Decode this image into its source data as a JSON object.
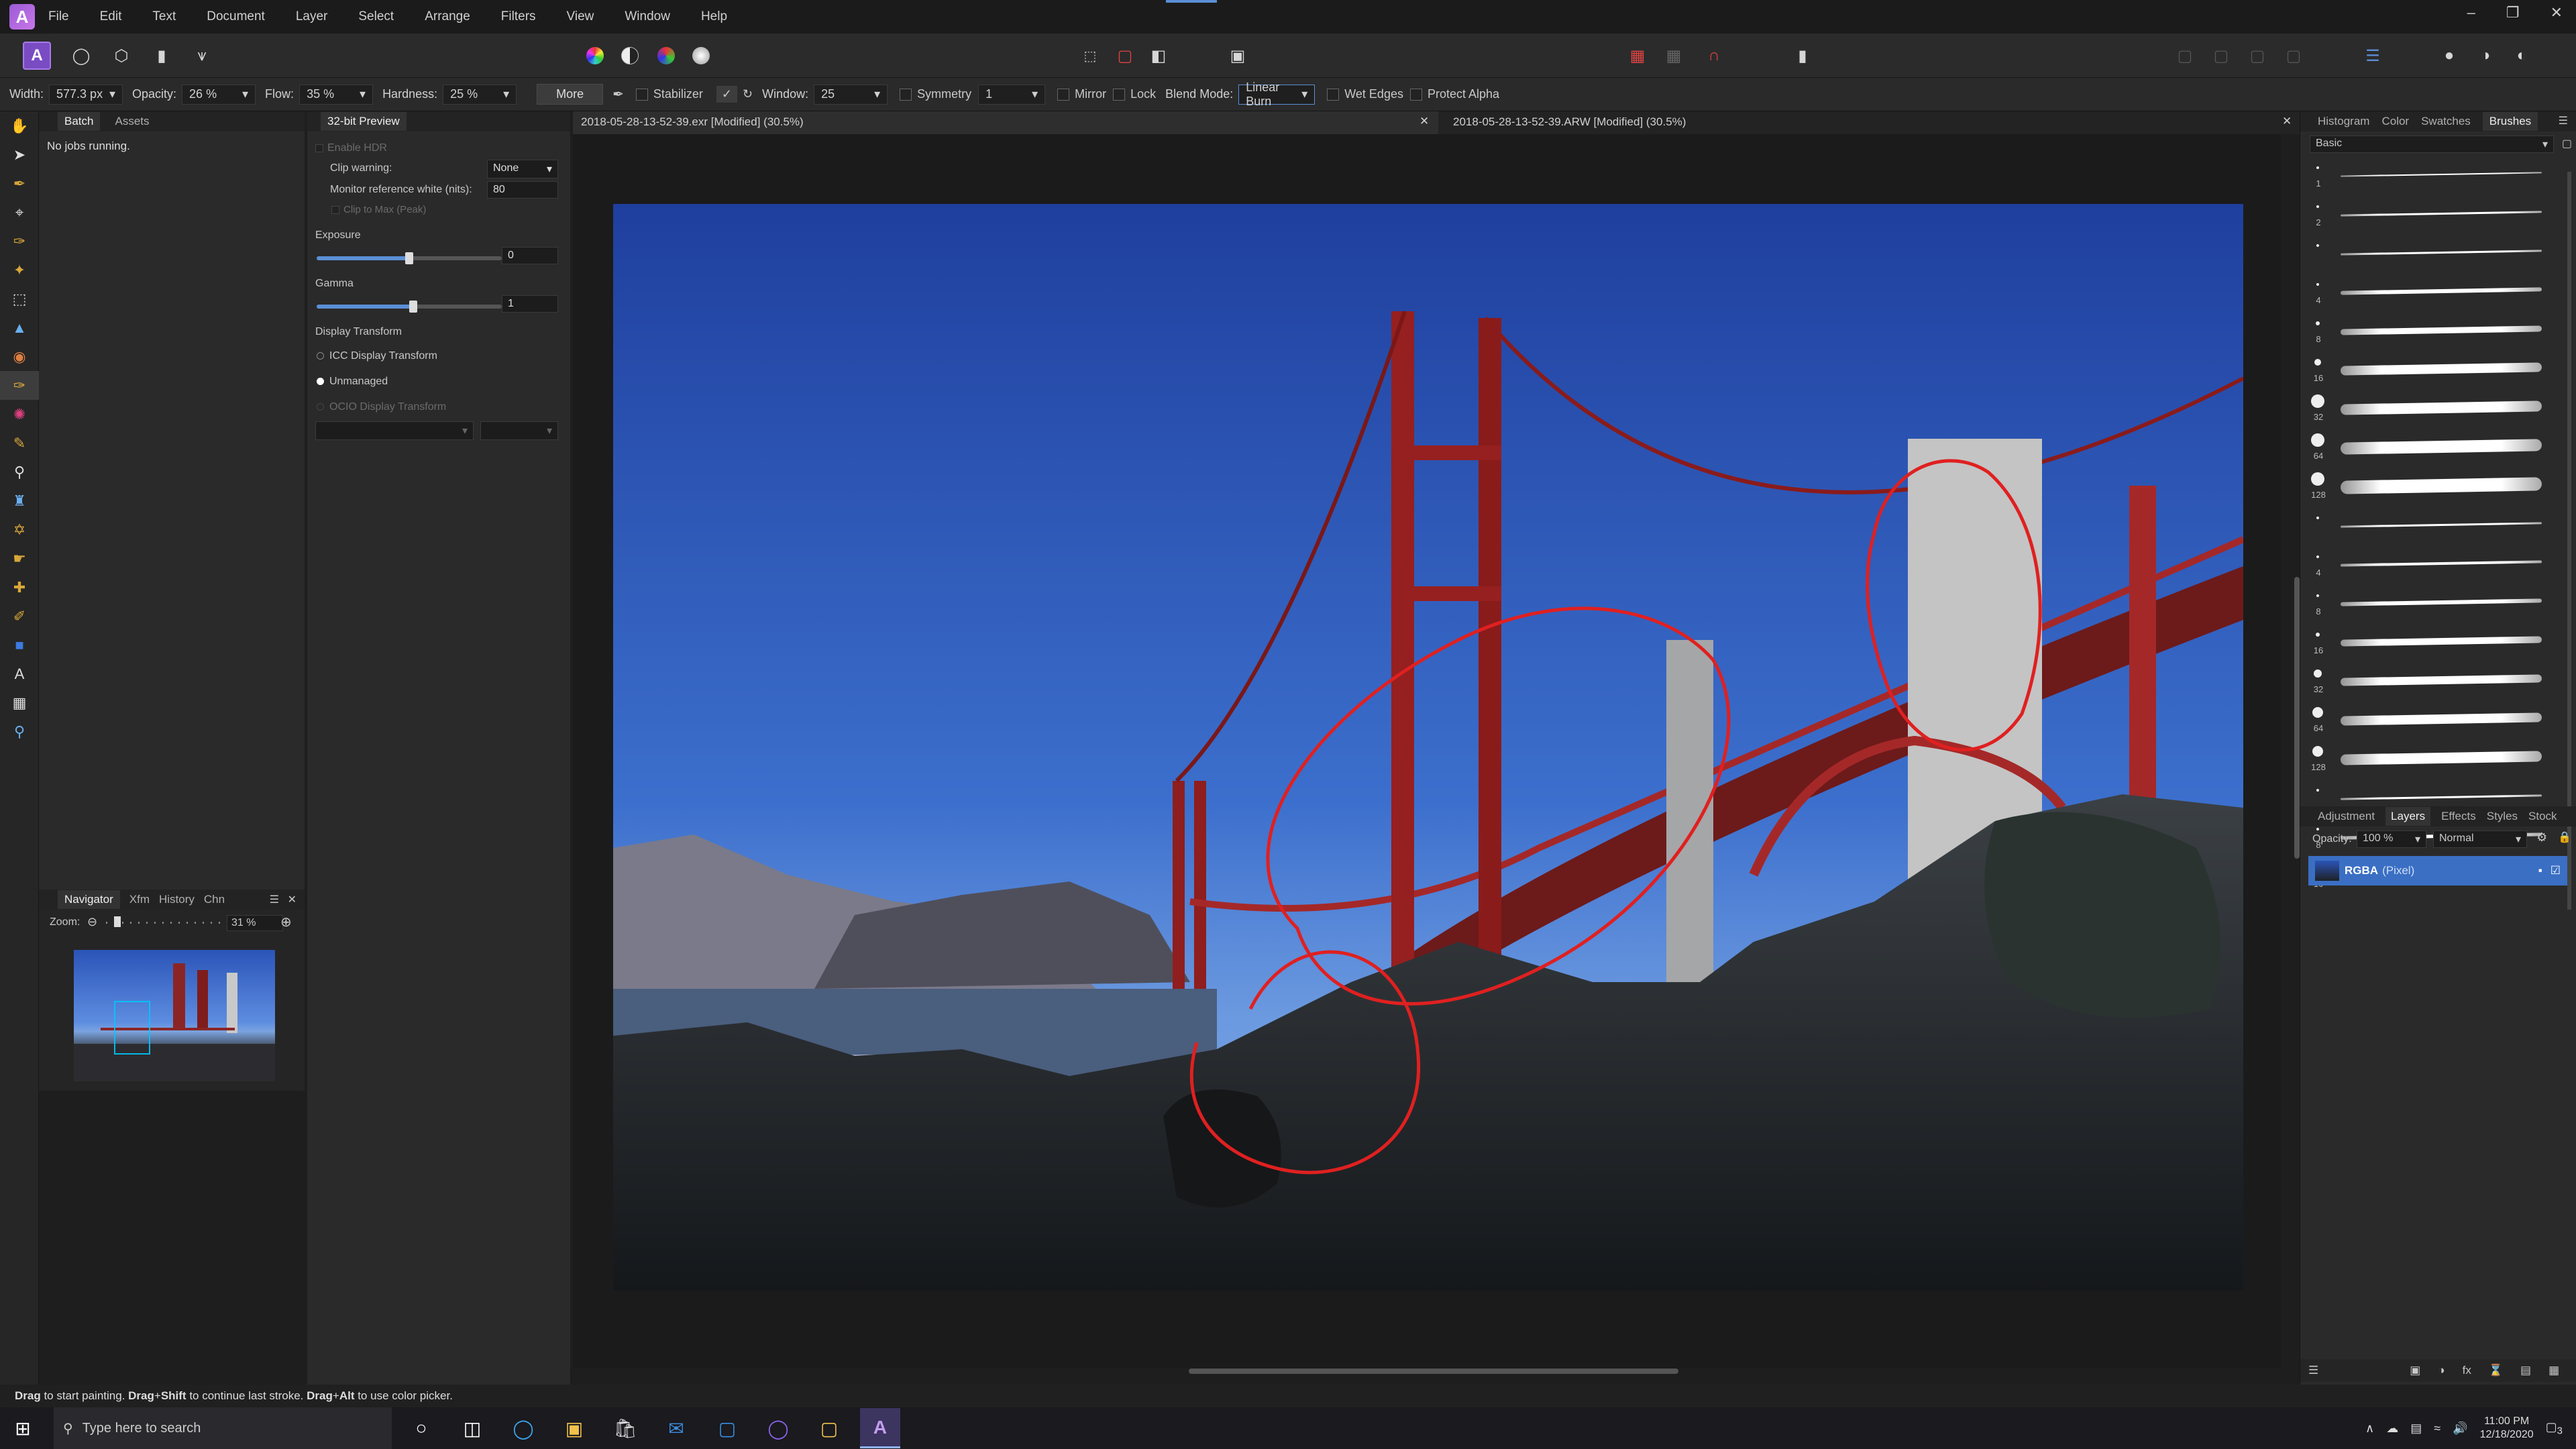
{
  "menubar": {
    "items": [
      "File",
      "Edit",
      "Text",
      "Document",
      "Layer",
      "Select",
      "Arrange",
      "Filters",
      "View",
      "Window",
      "Help"
    ]
  },
  "context": {
    "width_label": "Width:",
    "width_value": "577.3 px",
    "opacity_label": "Opacity:",
    "opacity_value": "26 %",
    "flow_label": "Flow:",
    "flow_value": "35 %",
    "hardness_label": "Hardness:",
    "hardness_value": "25 %",
    "more": "More",
    "stabilizer": "Stabilizer",
    "window_label": "Window:",
    "window_value": "25",
    "symmetry": "Symmetry",
    "symmetry_value": "1",
    "mirror": "Mirror",
    "lock": "Lock",
    "blend_label": "Blend Mode:",
    "blend_value": "Linear Burn",
    "wet_edges": "Wet Edges",
    "protect_alpha": "Protect Alpha"
  },
  "batch_panel": {
    "tabs": [
      "Batch",
      "Assets"
    ],
    "status": "No jobs running."
  },
  "hdr_panel": {
    "tab": "32-bit Preview",
    "enable_hdr": "Enable HDR",
    "clip_warning": "Clip warning:",
    "clip_warning_value": "None",
    "monitor_ref": "Monitor reference white (nits):",
    "monitor_ref_value": "80",
    "clip_max": "Clip to Max (Peak)",
    "exposure_label": "Exposure",
    "exposure_value": "0",
    "exposure_level": 0.5,
    "gamma_label": "Gamma",
    "gamma_value": "1",
    "gamma_level": 0.52,
    "display_transform": "Display Transform",
    "icc": "ICC Display Transform",
    "unmanaged": "Unmanaged",
    "ocio": "OCIO Display Transform"
  },
  "navigator": {
    "tabs": [
      "Navigator",
      "Xfm",
      "History",
      "Chn"
    ],
    "zoom_label": "Zoom:",
    "zoom_value": "31 %"
  },
  "documents": {
    "tab1": "2018-05-28-13-52-39.exr [Modified] (30.5%)",
    "tab2": "2018-05-28-13-52-39.ARW [Modified] (30.5%)"
  },
  "right_top": {
    "tabs": [
      "Histogram",
      "Color",
      "Swatches",
      "Brushes"
    ],
    "category": "Basic",
    "brush_sizes": [
      "1",
      "2",
      "",
      "4",
      "8",
      "16",
      "32",
      "64",
      "128",
      "",
      "4",
      "8",
      "16",
      "32",
      "64",
      "128",
      "",
      "8",
      "16"
    ]
  },
  "layers_panel": {
    "tabs": [
      "Adjustment",
      "Layers",
      "Effects",
      "Styles",
      "Stock"
    ],
    "opacity_label": "Opacity:",
    "opacity_value": "100 %",
    "blend": "Normal",
    "layer_name": "RGBA",
    "layer_type": "(Pixel)"
  },
  "status": {
    "d1": "Drag",
    "t1": " to start painting. ",
    "d2": "Drag",
    "t2": "+",
    "d3": "Shift",
    "t3": " to continue last stroke. ",
    "d4": "Drag",
    "t4": "+",
    "d5": "Alt",
    "t5": " to use color picker."
  },
  "taskbar": {
    "search": "Type here to search",
    "time": "11:00 PM",
    "date": "12/18/2020",
    "notif": "3"
  },
  "colors": {
    "accent": "#5b8fd6",
    "annotation": "#e02020",
    "persona": "#7a4cc4"
  }
}
